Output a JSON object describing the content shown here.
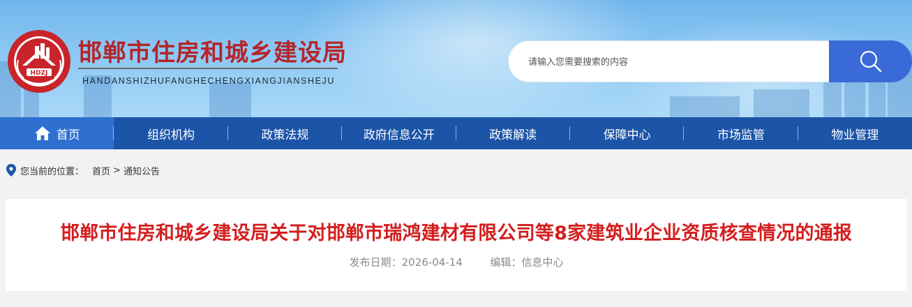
{
  "header": {
    "title": "邯郸市住房和城乡建设局",
    "subtitle": "HANDANSHIZHUFANGHECHENGXIANGJIANSHEJU",
    "logo_text": "HDZJ"
  },
  "search": {
    "placeholder": "请输入您需要搜索的内容",
    "value": ""
  },
  "nav": {
    "items": [
      {
        "label": "首页",
        "active": true
      },
      {
        "label": "组织机构"
      },
      {
        "label": "政策法规"
      },
      {
        "label": "政府信息公开"
      },
      {
        "label": "政策解读"
      },
      {
        "label": "保障中心"
      },
      {
        "label": "市场监管"
      },
      {
        "label": "物业管理"
      }
    ]
  },
  "breadcrumb": {
    "label": "您当前的位置：",
    "home": "首页",
    "separator": ">",
    "current": "通知公告"
  },
  "article": {
    "title": "邯郸市住房和城乡建设局关于对邯郸市瑞鸿建材有限公司等8家建筑业企业资质核查情况的通报",
    "date_label": "发布日期：",
    "date": "2026-04-14",
    "editor_label": "编辑：",
    "editor": "信息中心"
  },
  "colors": {
    "nav_bg": "#1c55a8",
    "nav_active": "#2f6fd0",
    "title_red": "#d31e1e",
    "brand_red": "#b5252a",
    "search_button": "#3a6ad8"
  },
  "icons": [
    "logo-emblem-icon",
    "search-icon",
    "home-icon",
    "location-pin-icon"
  ]
}
